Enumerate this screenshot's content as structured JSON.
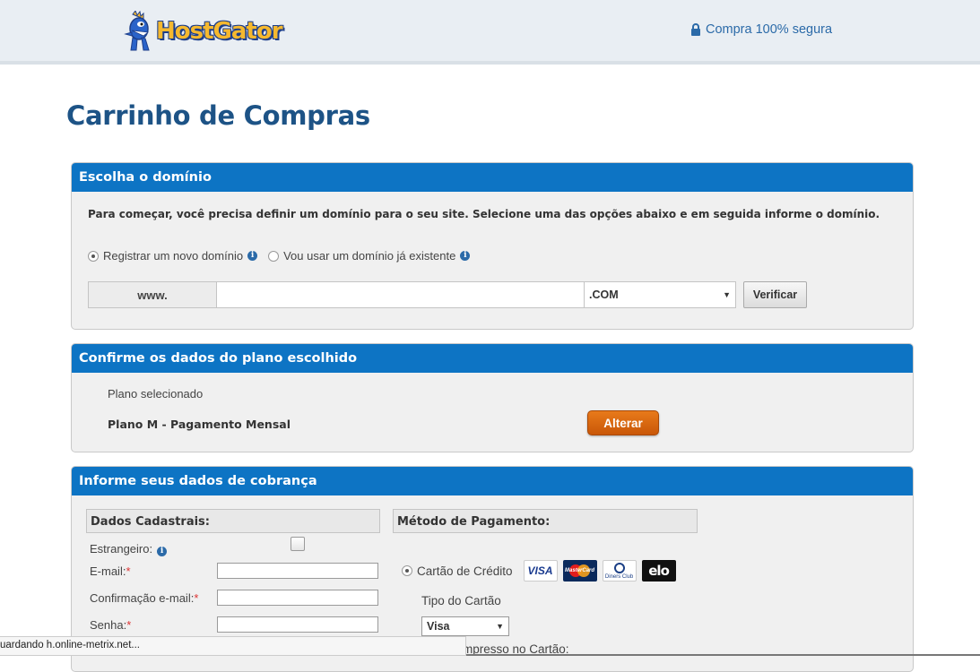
{
  "header": {
    "logo_text": "HostGator",
    "secure_text": "Compra 100% segura"
  },
  "page": {
    "title": "Carrinho de Compras"
  },
  "domain_panel": {
    "heading": "Escolha o domínio",
    "instructions": "Para começar, você precisa definir um domínio para o seu site. Selecione uma das opções abaixo e em seguida informe o domínio.",
    "option_new": "Registrar um novo domínio",
    "option_existing": "Vou usar um domínio já existente",
    "selected_option": "option_new",
    "prefix": "www.",
    "domain_value": "",
    "tld_selected": ".COM",
    "verify_label": "Verificar"
  },
  "plan_panel": {
    "heading": "Confirme os dados do plano escolhido",
    "label": "Plano selecionado",
    "plan_name": "Plano M - Pagamento Mensal",
    "change_label": "Alterar"
  },
  "billing_panel": {
    "heading": "Informe seus dados de cobrança",
    "personal_heading": "Dados Cadastrais:",
    "payment_heading": "Método de Pagamento:",
    "foreigner_label": "Estrangeiro:",
    "email_label": "E-mail:",
    "confirm_email_label": "Confirmação e-mail:",
    "password_label": "Senha:",
    "required_mark": "*",
    "credit_card_label": "Cartão de Crédito",
    "card_brands": [
      "VISA",
      "MasterCard",
      "Diners Club",
      "elo"
    ],
    "card_type_label": "Tipo do Cartão",
    "card_type_selected": "Visa",
    "name_on_card_partial": "mpresso no Cartão:"
  },
  "statusbar": {
    "text": "uardando h.online-metrix.net..."
  }
}
